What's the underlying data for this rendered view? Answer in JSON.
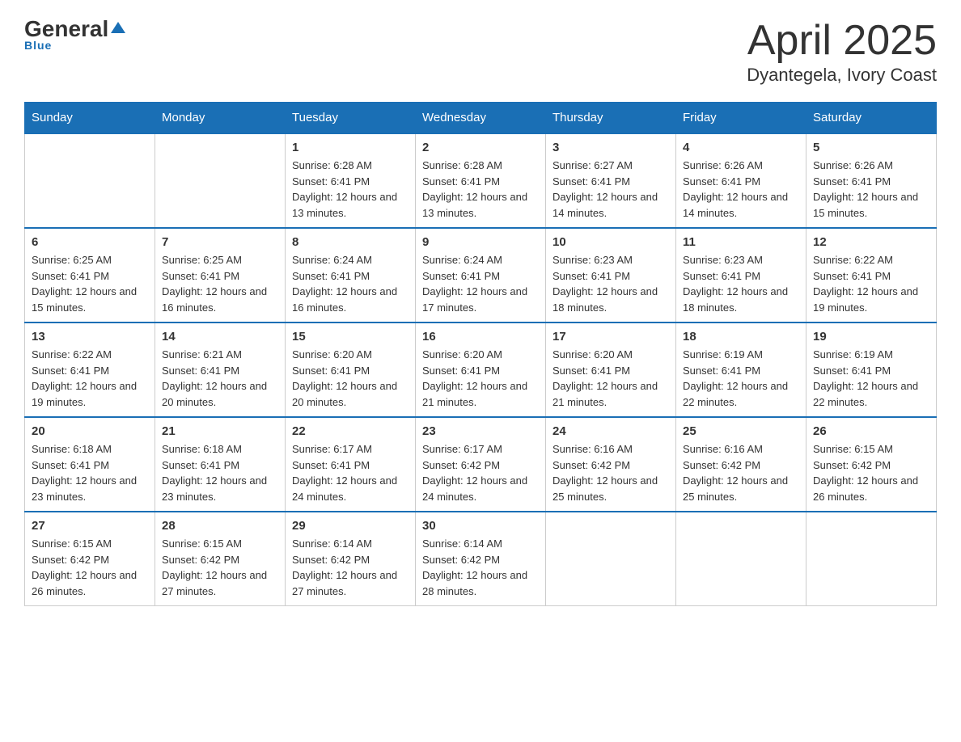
{
  "header": {
    "logo": {
      "general": "General",
      "blue": "Blue"
    },
    "title": "April 2025",
    "location": "Dyantegela, Ivory Coast"
  },
  "columns": [
    "Sunday",
    "Monday",
    "Tuesday",
    "Wednesday",
    "Thursday",
    "Friday",
    "Saturday"
  ],
  "weeks": [
    [
      {
        "day": "",
        "sunrise": "",
        "sunset": "",
        "daylight": ""
      },
      {
        "day": "",
        "sunrise": "",
        "sunset": "",
        "daylight": ""
      },
      {
        "day": "1",
        "sunrise": "Sunrise: 6:28 AM",
        "sunset": "Sunset: 6:41 PM",
        "daylight": "Daylight: 12 hours and 13 minutes."
      },
      {
        "day": "2",
        "sunrise": "Sunrise: 6:28 AM",
        "sunset": "Sunset: 6:41 PM",
        "daylight": "Daylight: 12 hours and 13 minutes."
      },
      {
        "day": "3",
        "sunrise": "Sunrise: 6:27 AM",
        "sunset": "Sunset: 6:41 PM",
        "daylight": "Daylight: 12 hours and 14 minutes."
      },
      {
        "day": "4",
        "sunrise": "Sunrise: 6:26 AM",
        "sunset": "Sunset: 6:41 PM",
        "daylight": "Daylight: 12 hours and 14 minutes."
      },
      {
        "day": "5",
        "sunrise": "Sunrise: 6:26 AM",
        "sunset": "Sunset: 6:41 PM",
        "daylight": "Daylight: 12 hours and 15 minutes."
      }
    ],
    [
      {
        "day": "6",
        "sunrise": "Sunrise: 6:25 AM",
        "sunset": "Sunset: 6:41 PM",
        "daylight": "Daylight: 12 hours and 15 minutes."
      },
      {
        "day": "7",
        "sunrise": "Sunrise: 6:25 AM",
        "sunset": "Sunset: 6:41 PM",
        "daylight": "Daylight: 12 hours and 16 minutes."
      },
      {
        "day": "8",
        "sunrise": "Sunrise: 6:24 AM",
        "sunset": "Sunset: 6:41 PM",
        "daylight": "Daylight: 12 hours and 16 minutes."
      },
      {
        "day": "9",
        "sunrise": "Sunrise: 6:24 AM",
        "sunset": "Sunset: 6:41 PM",
        "daylight": "Daylight: 12 hours and 17 minutes."
      },
      {
        "day": "10",
        "sunrise": "Sunrise: 6:23 AM",
        "sunset": "Sunset: 6:41 PM",
        "daylight": "Daylight: 12 hours and 18 minutes."
      },
      {
        "day": "11",
        "sunrise": "Sunrise: 6:23 AM",
        "sunset": "Sunset: 6:41 PM",
        "daylight": "Daylight: 12 hours and 18 minutes."
      },
      {
        "day": "12",
        "sunrise": "Sunrise: 6:22 AM",
        "sunset": "Sunset: 6:41 PM",
        "daylight": "Daylight: 12 hours and 19 minutes."
      }
    ],
    [
      {
        "day": "13",
        "sunrise": "Sunrise: 6:22 AM",
        "sunset": "Sunset: 6:41 PM",
        "daylight": "Daylight: 12 hours and 19 minutes."
      },
      {
        "day": "14",
        "sunrise": "Sunrise: 6:21 AM",
        "sunset": "Sunset: 6:41 PM",
        "daylight": "Daylight: 12 hours and 20 minutes."
      },
      {
        "day": "15",
        "sunrise": "Sunrise: 6:20 AM",
        "sunset": "Sunset: 6:41 PM",
        "daylight": "Daylight: 12 hours and 20 minutes."
      },
      {
        "day": "16",
        "sunrise": "Sunrise: 6:20 AM",
        "sunset": "Sunset: 6:41 PM",
        "daylight": "Daylight: 12 hours and 21 minutes."
      },
      {
        "day": "17",
        "sunrise": "Sunrise: 6:20 AM",
        "sunset": "Sunset: 6:41 PM",
        "daylight": "Daylight: 12 hours and 21 minutes."
      },
      {
        "day": "18",
        "sunrise": "Sunrise: 6:19 AM",
        "sunset": "Sunset: 6:41 PM",
        "daylight": "Daylight: 12 hours and 22 minutes."
      },
      {
        "day": "19",
        "sunrise": "Sunrise: 6:19 AM",
        "sunset": "Sunset: 6:41 PM",
        "daylight": "Daylight: 12 hours and 22 minutes."
      }
    ],
    [
      {
        "day": "20",
        "sunrise": "Sunrise: 6:18 AM",
        "sunset": "Sunset: 6:41 PM",
        "daylight": "Daylight: 12 hours and 23 minutes."
      },
      {
        "day": "21",
        "sunrise": "Sunrise: 6:18 AM",
        "sunset": "Sunset: 6:41 PM",
        "daylight": "Daylight: 12 hours and 23 minutes."
      },
      {
        "day": "22",
        "sunrise": "Sunrise: 6:17 AM",
        "sunset": "Sunset: 6:41 PM",
        "daylight": "Daylight: 12 hours and 24 minutes."
      },
      {
        "day": "23",
        "sunrise": "Sunrise: 6:17 AM",
        "sunset": "Sunset: 6:42 PM",
        "daylight": "Daylight: 12 hours and 24 minutes."
      },
      {
        "day": "24",
        "sunrise": "Sunrise: 6:16 AM",
        "sunset": "Sunset: 6:42 PM",
        "daylight": "Daylight: 12 hours and 25 minutes."
      },
      {
        "day": "25",
        "sunrise": "Sunrise: 6:16 AM",
        "sunset": "Sunset: 6:42 PM",
        "daylight": "Daylight: 12 hours and 25 minutes."
      },
      {
        "day": "26",
        "sunrise": "Sunrise: 6:15 AM",
        "sunset": "Sunset: 6:42 PM",
        "daylight": "Daylight: 12 hours and 26 minutes."
      }
    ],
    [
      {
        "day": "27",
        "sunrise": "Sunrise: 6:15 AM",
        "sunset": "Sunset: 6:42 PM",
        "daylight": "Daylight: 12 hours and 26 minutes."
      },
      {
        "day": "28",
        "sunrise": "Sunrise: 6:15 AM",
        "sunset": "Sunset: 6:42 PM",
        "daylight": "Daylight: 12 hours and 27 minutes."
      },
      {
        "day": "29",
        "sunrise": "Sunrise: 6:14 AM",
        "sunset": "Sunset: 6:42 PM",
        "daylight": "Daylight: 12 hours and 27 minutes."
      },
      {
        "day": "30",
        "sunrise": "Sunrise: 6:14 AM",
        "sunset": "Sunset: 6:42 PM",
        "daylight": "Daylight: 12 hours and 28 minutes."
      },
      {
        "day": "",
        "sunrise": "",
        "sunset": "",
        "daylight": ""
      },
      {
        "day": "",
        "sunrise": "",
        "sunset": "",
        "daylight": ""
      },
      {
        "day": "",
        "sunrise": "",
        "sunset": "",
        "daylight": ""
      }
    ]
  ]
}
